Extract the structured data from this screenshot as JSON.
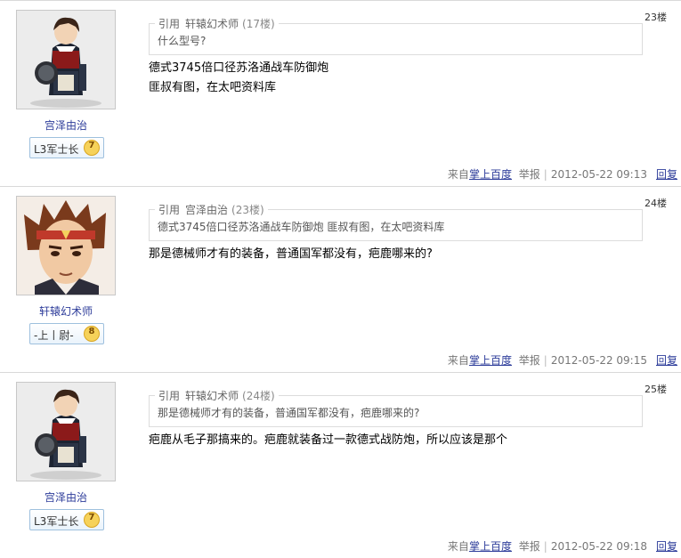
{
  "posts": [
    {
      "username": "宫泽由治",
      "level_name": "L3军士长",
      "level_num": "7",
      "floor": "23楼",
      "quote": {
        "ref": "引用",
        "author": "轩辕幻术师",
        "floor": "(17楼)",
        "text": "什么型号?"
      },
      "content": [
        "德式3745倍口径苏洛通战车防御炮",
        "匪叔有图，在太吧资料库"
      ],
      "source_prefix": "来自",
      "source_link": "掌上百度",
      "report": "举报",
      "time": "2012-05-22 09:13",
      "reply": "回复",
      "avatar": "kendo-figure-avatar"
    },
    {
      "username": "轩辕幻术师",
      "level_name": "-上丨尉-",
      "level_num": "8",
      "floor": "24楼",
      "quote": {
        "ref": "引用",
        "author": "宫泽由治",
        "floor": "(23楼)",
        "text": "德式3745倍口径苏洛通战车防御炮 匪叔有图，在太吧资料库"
      },
      "content": [
        "那是德械师才有的装备，普通国军都没有，疤鹿哪来的?"
      ],
      "source_prefix": "来自",
      "source_link": "掌上百度",
      "report": "举报",
      "time": "2012-05-22 09:15",
      "reply": "回复",
      "avatar": "warrior-headband-avatar"
    },
    {
      "username": "宫泽由治",
      "level_name": "L3军士长",
      "level_num": "7",
      "floor": "25楼",
      "quote": {
        "ref": "引用",
        "author": "轩辕幻术师",
        "floor": "(24楼)",
        "text": "那是德械师才有的装备，普通国军都没有，疤鹿哪来的?"
      },
      "content": [
        "疤鹿从毛子那搞来的。疤鹿就装备过一款德式战防炮，所以应该是那个"
      ],
      "source_prefix": "来自",
      "source_link": "掌上百度",
      "report": "举报",
      "time": "2012-05-22 09:18",
      "reply": "回复",
      "avatar": "kendo-figure-avatar"
    }
  ],
  "colors": {
    "link": "#2d3c9a",
    "border": "#d9d9d9",
    "badge": "#f3c545"
  }
}
